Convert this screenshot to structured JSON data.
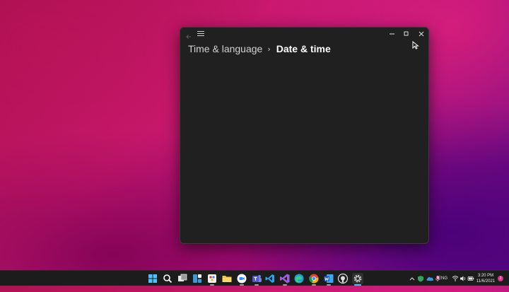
{
  "window": {
    "breadcrumb": {
      "parent": "Time & language",
      "separator": "›",
      "current": "Date & time"
    },
    "controls": [
      "minimize-icon",
      "maximize-icon",
      "close-icon"
    ]
  },
  "taskbar": {
    "apps": [
      {
        "name": "start",
        "icon": "windows-logo-icon"
      },
      {
        "name": "search",
        "icon": "search-icon"
      },
      {
        "name": "task-view",
        "icon": "task-view-icon"
      },
      {
        "name": "widgets",
        "icon": "widgets-icon"
      },
      {
        "name": "paint",
        "icon": "paint-icon"
      },
      {
        "name": "file-explorer",
        "icon": "folder-icon"
      },
      {
        "name": "zoom",
        "icon": "zoom-icon"
      },
      {
        "name": "teams",
        "icon": "teams-icon"
      },
      {
        "name": "vs-code",
        "icon": "vscode-icon"
      },
      {
        "name": "visual-studio",
        "icon": "visual-studio-icon"
      },
      {
        "name": "edge",
        "icon": "edge-icon"
      },
      {
        "name": "chrome",
        "icon": "chrome-icon"
      },
      {
        "name": "word",
        "icon": "word-icon"
      },
      {
        "name": "github",
        "icon": "github-icon"
      },
      {
        "name": "settings",
        "icon": "gear-icon"
      }
    ],
    "tray": {
      "language": "ENG",
      "time": "3:20 PM",
      "date": "11/6/2021",
      "notification_count": "2"
    }
  },
  "colors": {
    "window_bg": "#202020",
    "taskbar_bg": "#1c1c1c",
    "accent": "#4cc2ff"
  }
}
